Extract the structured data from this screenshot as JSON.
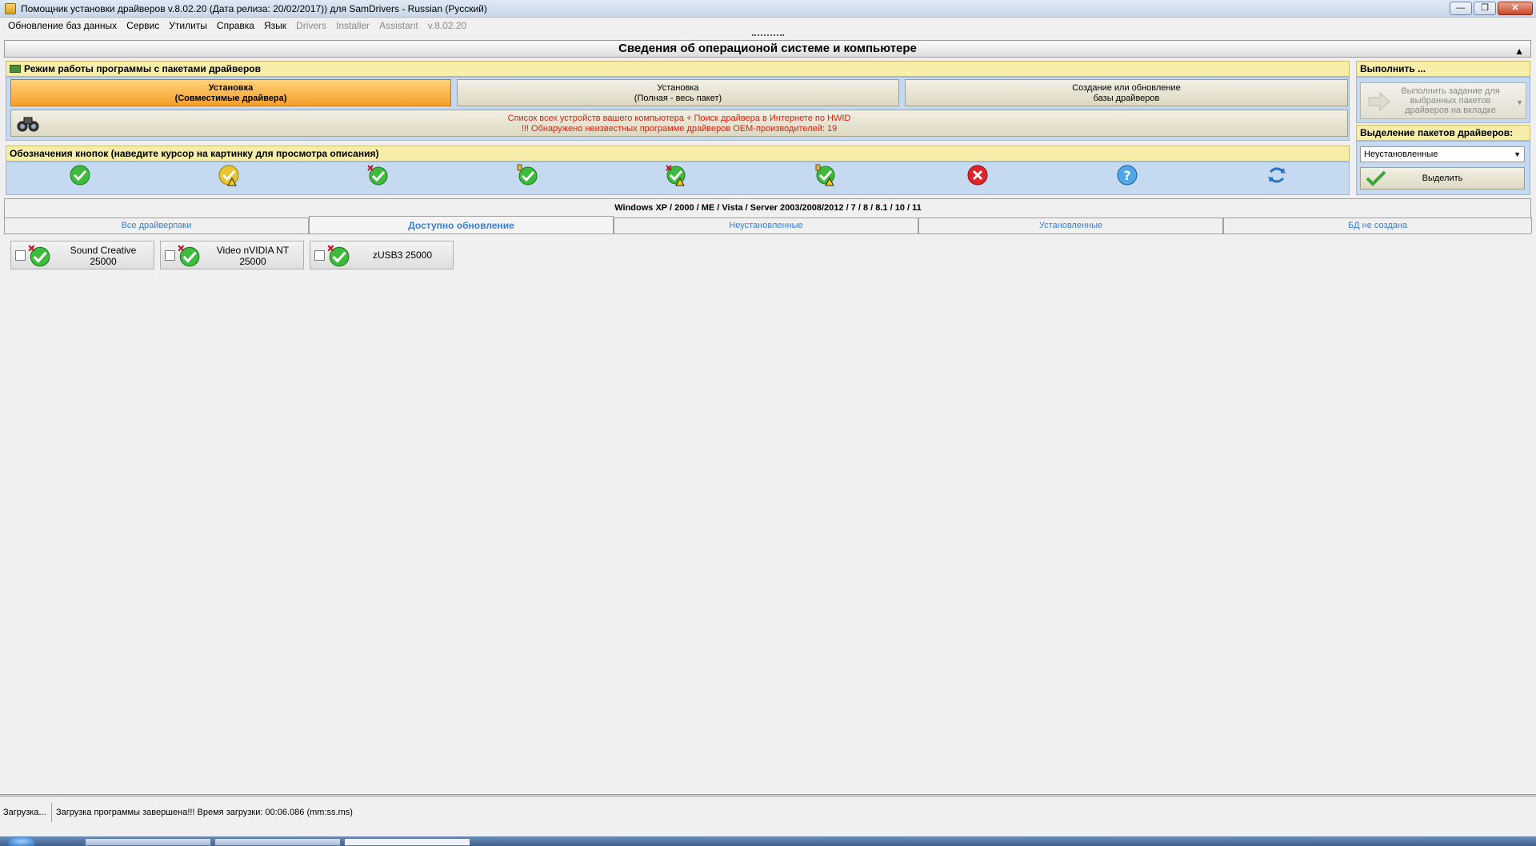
{
  "window": {
    "title": "Помощник установки драйверов v.8.02.20 (Дата релиза: 20/02/2017)) для SamDrivers - Russian (Русский)",
    "buttons": {
      "minimize": "—",
      "maximize": "❐",
      "close": "✕"
    }
  },
  "menu": {
    "items": [
      "Обновление баз данных",
      "Сервис",
      "Утилиты",
      "Справка",
      "Язык"
    ],
    "disabled_items": [
      "Drivers",
      "Installer",
      "Assistant",
      "v.8.02.20"
    ]
  },
  "section": {
    "title": "Сведения об операционой системе и компьютере",
    "collapse_icon": "triangle-up-icon"
  },
  "mode_panel": {
    "header": "Режим работы программы с пакетами драйверов",
    "buttons": [
      {
        "line1": "Установка",
        "line2": "(Совместимые драйвера)"
      },
      {
        "line1": "Установка",
        "line2": "(Полная - весь пакет)"
      },
      {
        "line1": "Создание или обновление",
        "line2": "базы драйверов"
      }
    ],
    "hwid": {
      "line1": "Список всех устройств вашего компьютера + Поиск драйвера в Интернете по HWID",
      "line2": "!!! Обнаружено неизвестных программе драйверов OEM-производителей:  19",
      "icon": "binoculars-icon"
    }
  },
  "legend_panel": {
    "header": "Обозначения кнопок (наведите курсор на картинку для просмотра описания)",
    "icons": [
      "green-check-icon",
      "yellow-check-warning-icon",
      "green-check-new-icon",
      "green-check-tool-icon",
      "green-check-new-warning-icon",
      "green-check-tool-warning-icon",
      "red-cross-icon",
      "blue-question-icon",
      "blue-refresh-arrows-icon"
    ]
  },
  "execute_panel": {
    "header": "Выполнить ...",
    "button_lines": [
      "Выполнить задание для",
      "выбранных пакетов",
      "драйверов на вкладке"
    ]
  },
  "selection_panel": {
    "header": "Выделение пакетов драйверов:",
    "selected": "Неустановленные",
    "button": "Выделить"
  },
  "main": {
    "os_header": "Windows XP / 2000 / ME / Vista / Server 2003/2008/2012 / 7 / 8 / 8.1 / 10 / 11",
    "tabs": [
      {
        "label": "Все драйверпаки"
      },
      {
        "label": "Доступно обновление"
      },
      {
        "label": "Неустановленные"
      },
      {
        "label": "Установленные"
      },
      {
        "label": "БД не создана"
      }
    ],
    "active_tab": "Доступно обновление",
    "packs": [
      {
        "line1": "Sound Creative",
        "line2": "25000"
      },
      {
        "line1": "Video nVIDIA NT",
        "line2": "25000"
      },
      {
        "line1": "zUSB3 25000",
        "line2": ""
      }
    ]
  },
  "status": {
    "left": "Загрузка...",
    "message": "Загрузка программы завершена!!! Время загрузки: 00:06.086 (mm:ss.ms)"
  },
  "colors": {
    "active_mode": "#f5a02a",
    "panel_header": "#f5eda8",
    "panel_bg": "#c5d9f1",
    "tab_text": "#3b7fd0",
    "hwid_text": "#d9230f"
  }
}
